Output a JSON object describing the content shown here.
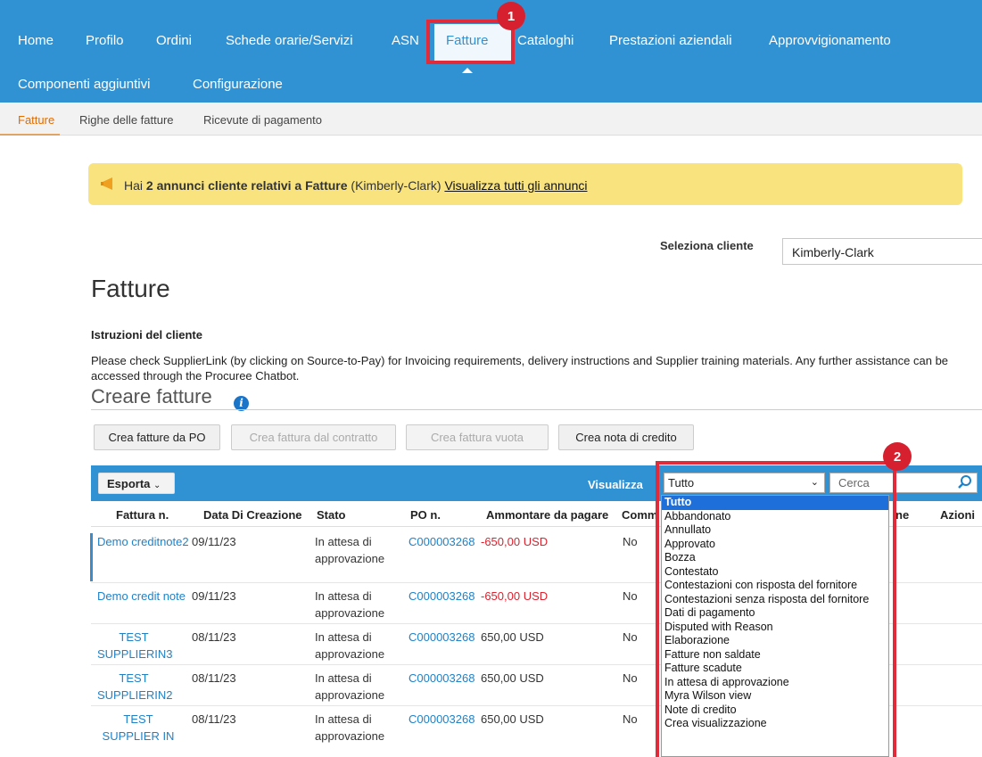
{
  "nav": {
    "row1": [
      "Home",
      "Profilo",
      "Ordini",
      "Schede orarie/Servizi",
      "ASN",
      "Fatture",
      "Cataloghi",
      "Prestazioni aziendali",
      "Approvvigionamento"
    ],
    "row2": [
      "Componenti aggiuntivi",
      "Configurazione"
    ],
    "active": "Fatture"
  },
  "subnav": [
    "Fatture",
    "Righe delle fatture",
    "Ricevute di pagamento"
  ],
  "callouts": [
    "1",
    "2"
  ],
  "banner": {
    "prefix": "Hai ",
    "bold": "2 annunci cliente relativi a Fatture",
    "suffix": " (Kimberly-Clark)  ",
    "link": "Visualizza tutti gli annunci"
  },
  "customer": {
    "label": "Seleziona cliente",
    "value": "Kimberly-Clark"
  },
  "page_title": "Fatture",
  "instructions": {
    "heading": "Istruzioni del cliente",
    "text": "Please check SupplierLink (by clicking on Source-to-Pay) for Invoicing requirements, delivery instructions and Supplier training materials. Any further assistance can be accessed through the Procuree Chatbot."
  },
  "create": {
    "title": "Creare fatture",
    "info_icon": "i",
    "buttons": [
      "Crea fatture da PO",
      "Crea fattura dal contratto",
      "Crea fattura vuota",
      "Crea nota di credito"
    ]
  },
  "toolbar": {
    "export": "Esporta",
    "view_label": "Visualizza",
    "view_value": "Tutto",
    "search_placeholder": "Cerca"
  },
  "table": {
    "headers": [
      "Fattura n.",
      "Data Di Creazione",
      "Stato",
      "PO n.",
      "Ammontare da pagare",
      "Comm",
      "ne",
      "Azioni"
    ],
    "rows": [
      {
        "invoice": "Demo creditnote2",
        "date": "09/11/23",
        "status": "In attesa di approvazione",
        "po": "C000003268",
        "amount": "-650,00 USD",
        "comm": "No"
      },
      {
        "invoice": "Demo credit note",
        "date": "09/11/23",
        "status": "In attesa di approvazione",
        "po": "C000003268",
        "amount": "-650,00 USD",
        "comm": "No"
      },
      {
        "invoice": "TEST SUPPLIERIN3",
        "date": "08/11/23",
        "status": "In attesa di approvazione",
        "po": "C000003268",
        "amount": "650,00 USD",
        "comm": "No"
      },
      {
        "invoice": "TEST SUPPLIERIN2",
        "date": "08/11/23",
        "status": "In attesa di approvazione",
        "po": "C000003268",
        "amount": "650,00 USD",
        "comm": "No"
      },
      {
        "invoice": "TEST SUPPLIER IN",
        "date": "08/11/23",
        "status": "In attesa di approvazione",
        "po": "C000003268",
        "amount": "650,00 USD",
        "comm": "No"
      }
    ]
  },
  "dropdown_options": [
    "Tutto",
    "Abbandonato",
    "Annullato",
    "Approvato",
    "Bozza",
    "Contestato",
    "Contestazioni con risposta del fornitore",
    "Contestazioni senza risposta del fornitore",
    "Dati di pagamento",
    "Disputed with Reason",
    "Elaborazione",
    "Fatture non saldate",
    "Fatture scadute",
    "In attesa di approvazione",
    "Myra Wilson view",
    "Note di credito",
    "Crea visualizzazione"
  ],
  "colors": {
    "nav": "#3192d3",
    "callout": "#d6202f",
    "banner": "#f8e37f",
    "link": "#1f82c9",
    "negative": "#d9232f"
  }
}
